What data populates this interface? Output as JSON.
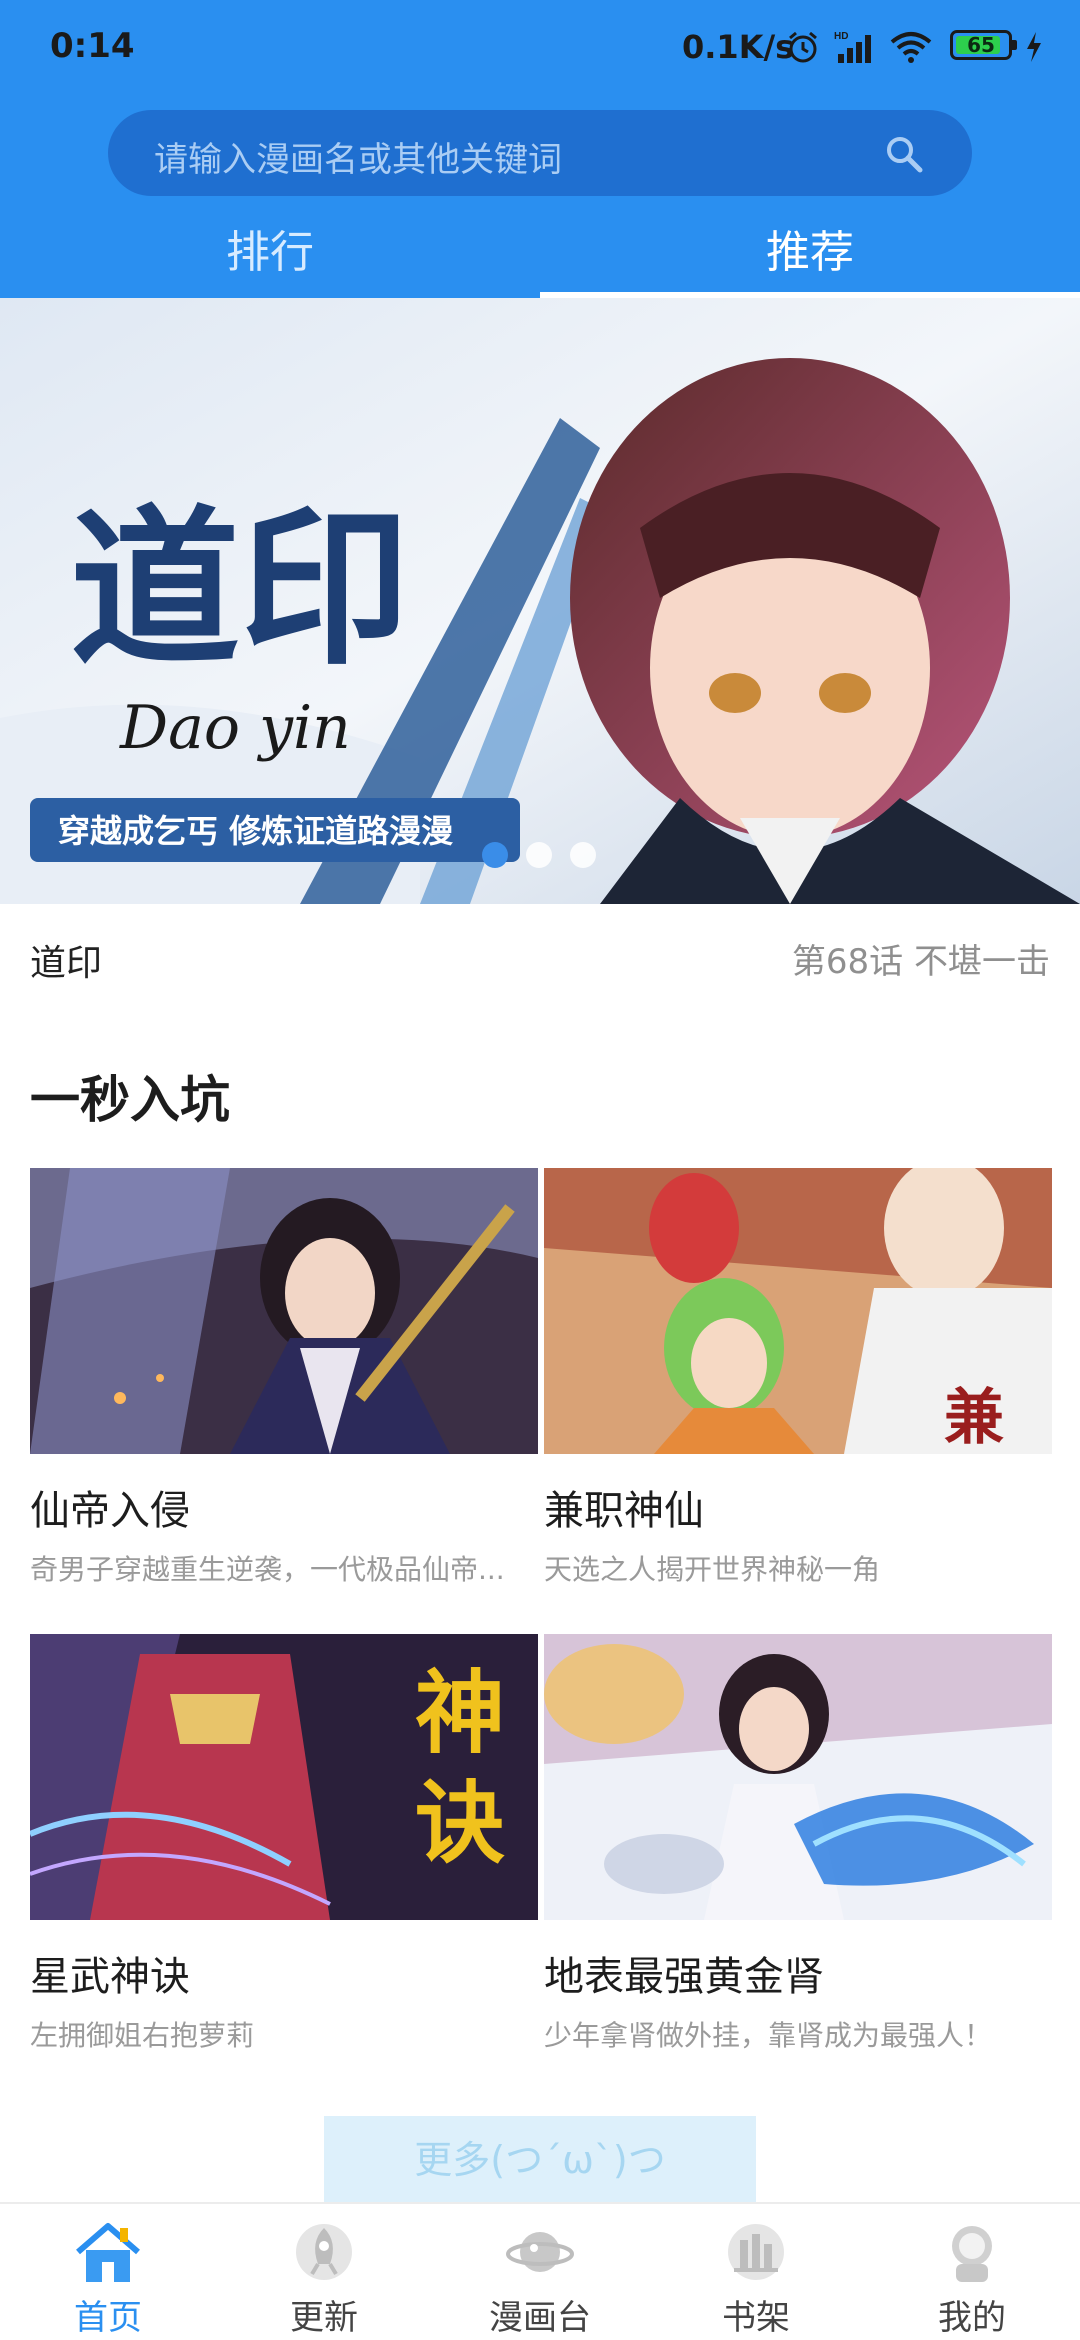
{
  "status_bar": {
    "time": "0:14",
    "network_speed": "0.1K/s",
    "battery_level": "65",
    "icons": [
      "alarm-icon",
      "signal-icon",
      "wifi-icon",
      "battery-icon",
      "charging-icon"
    ]
  },
  "search": {
    "placeholder": "请输入漫画名或其他关键词",
    "icon": "search-icon"
  },
  "tabs": [
    {
      "label": "排行",
      "active": false
    },
    {
      "label": "推荐",
      "active": true
    }
  ],
  "banner": {
    "title_art": "道印",
    "title_latin": "Dao yin",
    "tagline": "穿越成乞丐 修炼证道路漫漫",
    "slide_count": 3,
    "active_slide": 1
  },
  "featured": {
    "title": "道印",
    "chapter": "第68话 不堪一击"
  },
  "section": {
    "title": "一秒入坑"
  },
  "cards": [
    {
      "name": "仙帝入侵",
      "desc": "奇男子穿越重生逆袭，一代极品仙帝..."
    },
    {
      "name": "兼职神仙",
      "desc": "天选之人揭开世界神秘一角"
    },
    {
      "name": "星武神诀",
      "desc": "左拥御姐右抱萝莉",
      "cover_text": "神诀"
    },
    {
      "name": "地表最强黄金肾",
      "desc": "少年拿肾做外挂，靠肾成为最强人！"
    }
  ],
  "more_button": "更多(つ´ω`)つ",
  "bottom_nav": [
    {
      "label": "首页",
      "icon": "home-icon",
      "active": true
    },
    {
      "label": "更新",
      "icon": "rocket-icon",
      "active": false
    },
    {
      "label": "漫画台",
      "icon": "planet-icon",
      "active": false
    },
    {
      "label": "书架",
      "icon": "bookshelf-icon",
      "active": false
    },
    {
      "label": "我的",
      "icon": "astronaut-icon",
      "active": false
    }
  ],
  "colors": {
    "primary": "#2a8ff0",
    "search_bg": "#1f6fd0",
    "more_bg": "#ddf0fb",
    "muted_text": "#9a9a9a"
  }
}
